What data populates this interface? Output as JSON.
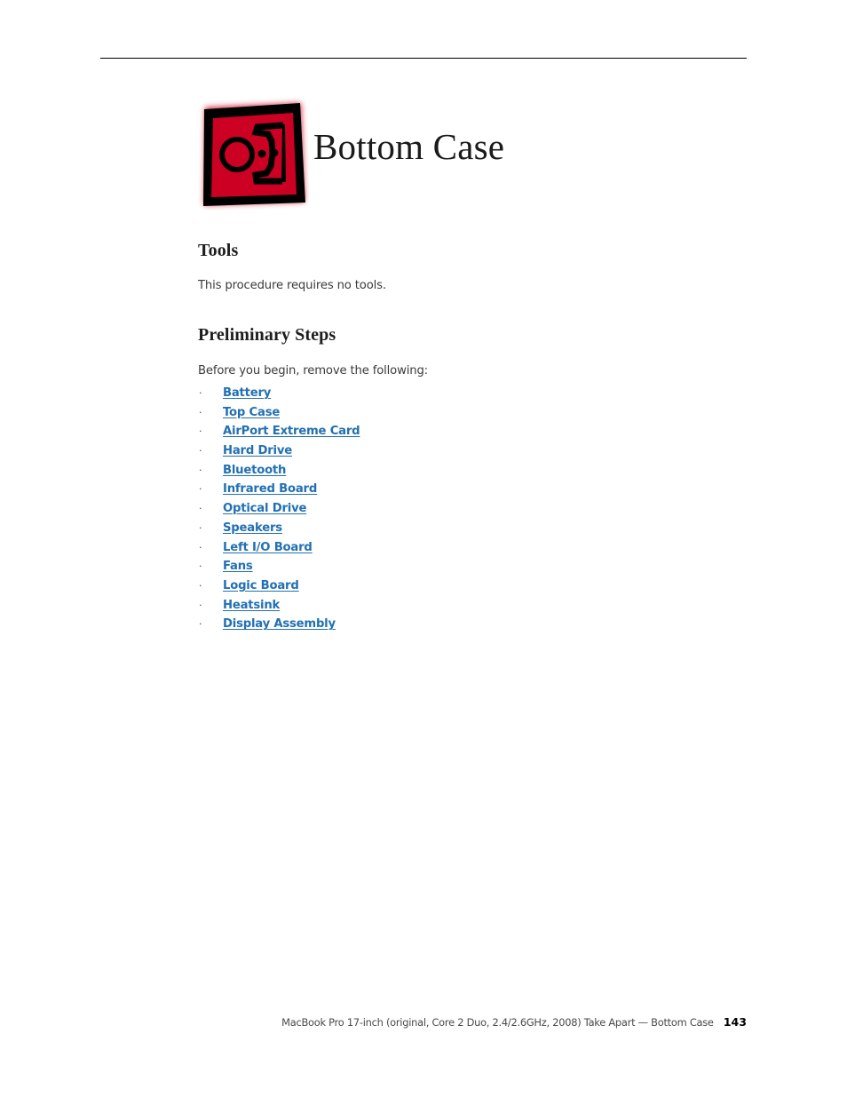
{
  "document": {
    "chapter_title": "Bottom Case",
    "icon_name": "apple-service-manual-chapter-icon",
    "icon_red": "#cc0022",
    "icon_outline": "#000000",
    "link_color": "#2270b3",
    "body_color": "#3b3b3b"
  },
  "sections": {
    "tools": {
      "heading": "Tools",
      "text": "This procedure requires no tools."
    },
    "preliminary": {
      "heading": "Preliminary Steps",
      "intro": "Before you begin, remove the following:",
      "bullet_glyph": "·",
      "items": [
        {
          "label": "Battery"
        },
        {
          "label": "Top Case"
        },
        {
          "label": "AirPort Extreme Card"
        },
        {
          "label": "Hard Drive"
        },
        {
          "label": "Bluetooth"
        },
        {
          "label": "Infrared Board"
        },
        {
          "label": "Optical Drive"
        },
        {
          "label": "Speakers"
        },
        {
          "label": "Left I/O Board"
        },
        {
          "label": "Fans"
        },
        {
          "label": "Logic Board"
        },
        {
          "label": "Heatsink"
        },
        {
          "label": "Display Assembly"
        }
      ]
    }
  },
  "footer": {
    "text": "MacBook Pro 17-inch (original, Core 2 Duo, 2.4/2.6GHz, 2008) Take Apart  —  Bottom Case",
    "page_number": "143"
  }
}
